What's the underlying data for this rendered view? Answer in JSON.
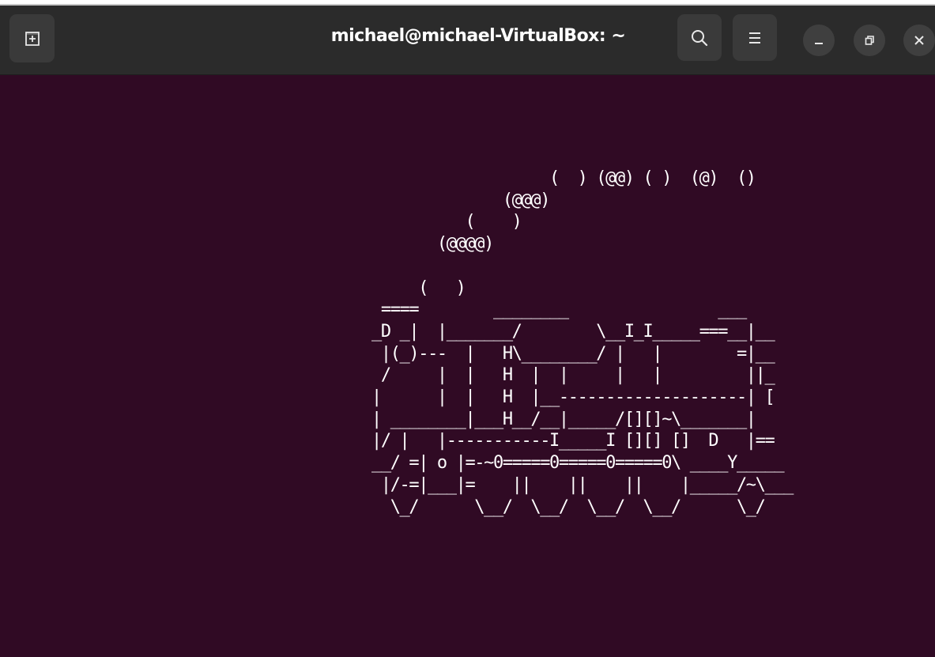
{
  "window": {
    "title": "michael@michael-VirtualBox: ~"
  },
  "toolbar": {
    "new_tab_icon": "new-tab-icon",
    "search_icon": "search-icon",
    "menu_icon": "hamburger-menu-icon",
    "minimize_icon": "minimize-icon",
    "maximize_icon": "restore-icon",
    "close_icon": "close-icon"
  },
  "terminal": {
    "background": "#300a24",
    "foreground": "#ffffff",
    "lines": [
      "                   (  ) (@@) ( )  (@)  ()",
      "              (@@@)",
      "          (    )",
      "       (@@@@)",
      "",
      "     (   )",
      " ====        ________                ___",
      "_D _|  |_______/        \\__I_I_____===__|__",
      " |(_)---  |   H\\________/ |   |        =|__",
      " /     |  |   H  |  |     |   |         ||_",
      "|      |  |   H  |__--------------------| [",
      "| ________|___H__/__|_____/[][]~\\_______|",
      "|/ |   |-----------I_____I [][] []  D   |==",
      "__/ =| o |=-~0=====0=====0=====0\\ ____Y_____",
      " |/-=|___|=    ||    ||    ||    |_____/~\\___",
      "  \\_/      \\__/  \\__/  \\__/  \\__/      \\_/"
    ]
  }
}
